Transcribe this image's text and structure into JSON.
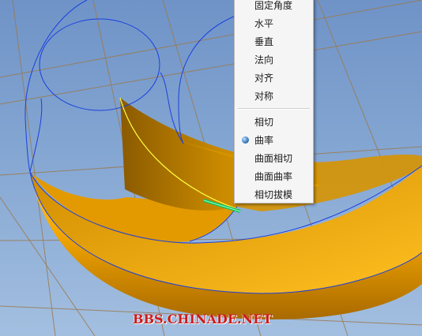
{
  "context_menu": {
    "items": [
      {
        "label": "固定角度",
        "selected": false
      },
      {
        "label": "水平",
        "selected": false
      },
      {
        "label": "垂直",
        "selected": false
      },
      {
        "label": "法向",
        "selected": false
      },
      {
        "label": "对齐",
        "selected": false
      },
      {
        "label": "对称",
        "selected": false
      },
      {
        "label": "相切",
        "selected": false
      },
      {
        "label": "曲率",
        "selected": true
      },
      {
        "label": "曲面相切",
        "selected": false
      },
      {
        "label": "曲面曲率",
        "selected": false
      },
      {
        "label": "相切拔模",
        "selected": false
      }
    ]
  },
  "watermark": "BBS.CHINADE.NET",
  "colors": {
    "background": "#7f9fcf",
    "surface": "#f0a800",
    "curve": "#1a40e0",
    "grid": "#9a7a50",
    "selected_edge": "#ffff40",
    "watermark": "#cc1a1a"
  }
}
